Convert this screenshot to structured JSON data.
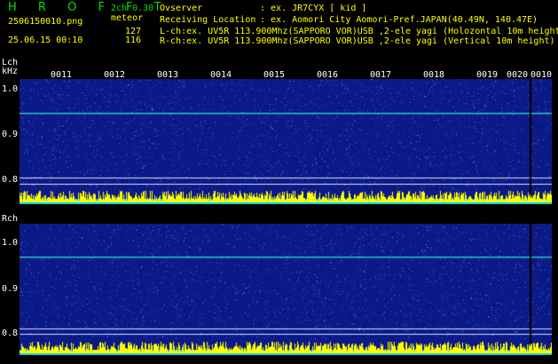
{
  "header": {
    "brand": "H R O F F T",
    "version": "2ch 0.30",
    "filename": "2506150010.png",
    "meteor_label": "meteor",
    "datetime": "25.06.15 00:10",
    "count_l": "127",
    "count_r": "116",
    "observer_label": "Ovserver",
    "observer_value": ": ex. JR7CYX [ kid ]",
    "location_label": "Receiving Location",
    "location_value": ": ex. Aomori City Aomori-Pref.JAPAN(40.49N, 140.47E)",
    "lch_info": "L-ch:ex. UV5R 113.900Mhz(SAPPORO VOR)USB ,2-ele yagi (Holozontal 10m height)",
    "rch_info": "R-ch:ex. UV5R 113.900Mhz(SAPPORO VOR)USB ,2-ele yagi (Vertical 10m height)"
  },
  "lch": {
    "label": "Lch",
    "unit": "kHz",
    "yticks": [
      "1.0",
      "0.9",
      "0.8"
    ]
  },
  "rch": {
    "label": "Rch",
    "yticks": [
      "1.0",
      "0.9",
      "0.8"
    ]
  },
  "time_ticks": [
    "0011",
    "0012",
    "0013",
    "0014",
    "0015",
    "0016",
    "0017",
    "0018",
    "0019",
    "0020",
    "0010"
  ],
  "colors": {
    "background": "#000000",
    "spectrogram": "#0b1a86",
    "signal": "#2bd3c8",
    "level_bars": "#ffff00",
    "level_base": "#00d0e0",
    "title_text": "#00e000"
  }
}
